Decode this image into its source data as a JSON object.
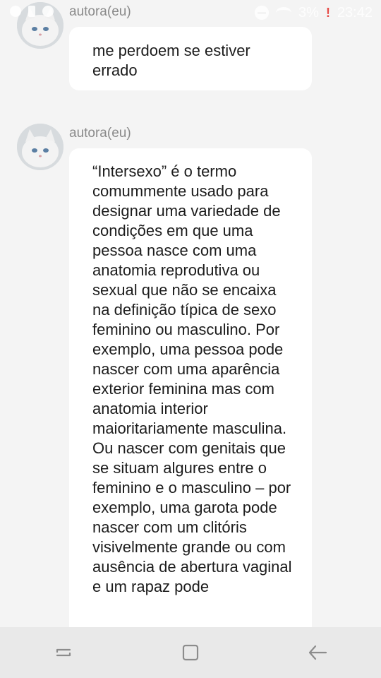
{
  "status_bar": {
    "battery": "3%",
    "time": "23:42",
    "icons": [
      "notification-icon",
      "battery-alert-icon",
      "chat-icon",
      "do-not-disturb-icon",
      "wifi-icon",
      "alert-icon"
    ]
  },
  "messages": [
    {
      "author": "autora(eu)",
      "text": "me perdoem se estiver errado"
    },
    {
      "author": "autora(eu)",
      "text": "“Intersexo” é o termo comummente usado para designar uma variedade de condições em que uma pessoa nasce com uma anatomia reprodutiva ou sexual que não se encaixa na definição típica de sexo feminino ou masculino. Por exemplo, uma pessoa pode nascer com uma aparência exterior feminina mas com anatomia interior maioritariamente masculina. Ou nascer com genitais que se situam algures entre o feminino e o masculino – por exemplo, uma garota pode nascer com um clitóris visivelmente grande ou com ausência de abertura vaginal e um rapaz pode"
    }
  ],
  "nav_bar": {
    "buttons": [
      "recent-apps",
      "home",
      "back"
    ]
  },
  "colors": {
    "background": "#f4f4f4",
    "bubble": "#ffffff",
    "author_text": "#8a8a8a",
    "nav_bar": "#e9e9e9"
  }
}
